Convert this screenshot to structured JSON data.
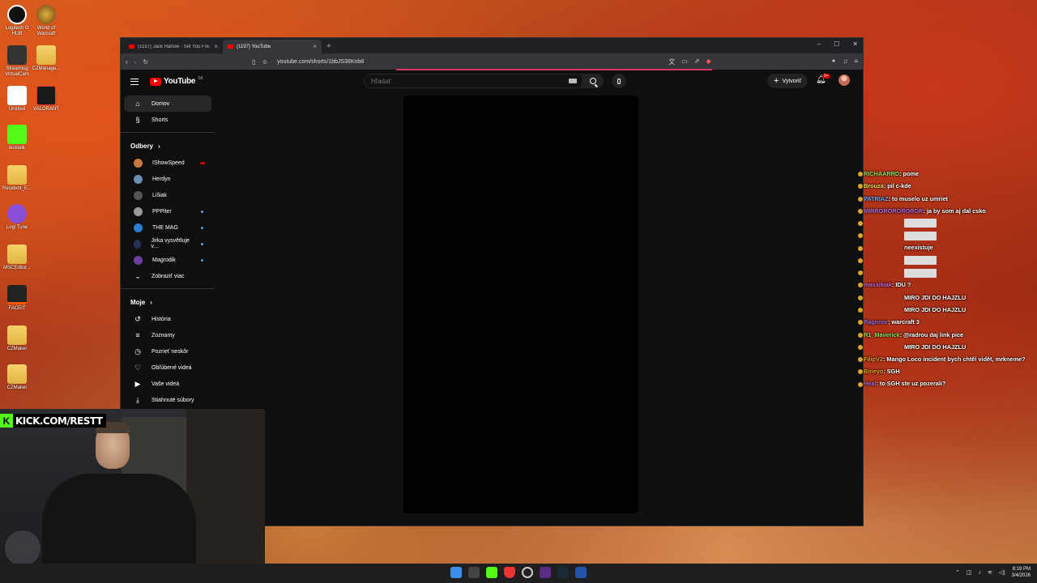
{
  "desktop": {
    "icons": [
      {
        "label": "Logitech G HUB"
      },
      {
        "label": "World of Warcraft"
      },
      {
        "label": "Streamlog VirtualCam"
      },
      {
        "label": "CZManage..."
      },
      {
        "label": "Untitled"
      },
      {
        "label": "VALORANT"
      },
      {
        "label": "kicktalk"
      },
      {
        "label": "Resident_E..."
      },
      {
        "label": "Logi Tune"
      },
      {
        "label": "MSCEditor..."
      },
      {
        "label": "FACEIT"
      },
      {
        "label": "CZMaker"
      },
      {
        "label": "CZMaker"
      }
    ]
  },
  "browser": {
    "tabs": [
      {
        "title": "(1197) Jack Harlow - Set You Fre..."
      },
      {
        "title": "(1197) YouTube"
      }
    ],
    "url": "youtube.com/shorts/1bbJS38Knb8"
  },
  "youtube": {
    "logo_text": "YouTube",
    "logo_country": "SK",
    "search_placeholder": "Hľadať",
    "create_label": "Vytvoriť",
    "notif_count": "9+",
    "nav": [
      {
        "label": "Domov",
        "icon": "home-icon"
      },
      {
        "label": "Shorts",
        "icon": "shorts-icon"
      }
    ],
    "subs_header": "Odbery",
    "subs": [
      {
        "label": "IShowSpeed",
        "color": "#c87a3a",
        "status": "live"
      },
      {
        "label": "Herdyn",
        "color": "#6a8fb0",
        "status": ""
      },
      {
        "label": "Lišiak",
        "color": "#555555",
        "status": ""
      },
      {
        "label": "PPPiter",
        "color": "#999999",
        "status": "dot"
      },
      {
        "label": "THE MAG",
        "color": "#2a7fd0",
        "status": "dot"
      },
      {
        "label": "Jirka vysvětluje v...",
        "color": "#223355",
        "status": "dot"
      },
      {
        "label": "Magrodik",
        "color": "#6b3fa0",
        "status": "dot"
      }
    ],
    "show_more": "Zobraziť viac",
    "you_header": "Moje",
    "you": [
      {
        "label": "História",
        "icon": "history-icon"
      },
      {
        "label": "Zoznamy",
        "icon": "playlists-icon"
      },
      {
        "label": "Pozrieť neskôr",
        "icon": "watch-later-icon"
      },
      {
        "label": "Obľúbené videá",
        "icon": "liked-icon"
      },
      {
        "label": "Vaše videá",
        "icon": "your-videos-icon"
      },
      {
        "label": "Stiahnuté súbory",
        "icon": "downloads-icon"
      }
    ]
  },
  "webcam": {
    "banner": "KICK.COM/RESTT"
  },
  "chat": [
    {
      "user": "RICHAARRD",
      "color": "#8ee35c",
      "msg": "pome"
    },
    {
      "user": "Brouza",
      "color": "#e8e35a",
      "msg": "pil c-kde"
    },
    {
      "user": "PATRIAZ",
      "color": "#6aa8ff",
      "msg": "to muselo uz umriet"
    },
    {
      "user": "MIRROROROROROR",
      "color": "#b06ad8",
      "msg": "ja by som aj dal csko",
      "wrap": true
    },
    {
      "user": "",
      "color": "#c04040",
      "msg": "",
      "emote": true
    },
    {
      "user": "",
      "color": "#c04040",
      "msg": "",
      "emote": true
    },
    {
      "user": "",
      "color": "#c04040",
      "msg": "neexistuje"
    },
    {
      "user": "",
      "color": "#c04040",
      "msg": "",
      "emote": true
    },
    {
      "user": "",
      "color": "#c04040",
      "msg": "",
      "emote": true
    },
    {
      "user": "maxxikiak",
      "color": "#c86ad8",
      "msg": "IDU ?"
    },
    {
      "user": "",
      "color": "#c04040",
      "msg": "MIRO JDI DO HAJZLU"
    },
    {
      "user": "",
      "color": "#c04040",
      "msg": "MIRO JDI DO HAJZLU"
    },
    {
      "user": "Ragnnor",
      "color": "#a06ad8",
      "msg": "warcraft 3"
    },
    {
      "user": "R1_Maverick",
      "color": "#8ee35c",
      "msg": "@radrou daj link pice"
    },
    {
      "user": "",
      "color": "#c04040",
      "msg": "MIRO JDI DO HAJZLU"
    },
    {
      "user": "FilipV2",
      "color": "#e3a32c",
      "msg": "Mango Loco incident bych chtěl vidět, mrkneme?",
      "wrap": true
    },
    {
      "user": "Bineyo",
      "color": "#e3a32c",
      "msg": "SGH"
    },
    {
      "user": "Heal",
      "color": "#b06ad8",
      "msg": "to SGH ste uz pozerali?"
    }
  ],
  "taskbar": {
    "time": "8:19 PM",
    "date": "3/4/2026"
  }
}
